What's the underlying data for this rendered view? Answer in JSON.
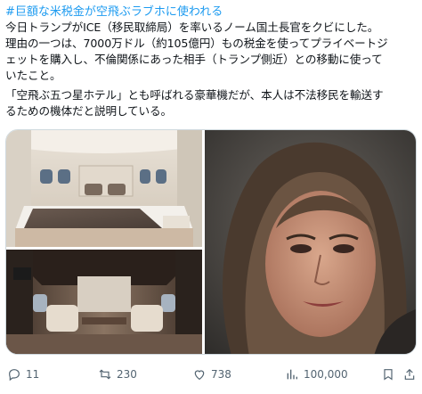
{
  "tweet": {
    "hashtag": "#巨額な米税金が空飛ぶラブホに使われる",
    "lines": [
      "今日トランプがICE（移民取締局）を率いるノーム国土長官をクビにした。",
      "理由の一つは、7000万ドル（約105億円）もの税金を使ってプライベートジ",
      "ェットを購入し、不倫関係にあった相手（トランプ側近）との移動に使って",
      "いたこと。",
      "「空飛ぶ五つ星ホテル」とも呼ばれる豪華機だが、本人は不法移民を輸送す",
      "るための機体だと説明している。"
    ]
  },
  "media": {
    "images": [
      {
        "name": "jet-bedroom-photo"
      },
      {
        "name": "jet-lounge-photo"
      },
      {
        "name": "woman-portrait-photo"
      }
    ]
  },
  "actions": {
    "reply_count": "11",
    "retweet_count": "230",
    "like_count": "738",
    "view_count": "100,000",
    "icons": [
      "reply-icon",
      "retweet-icon",
      "like-icon",
      "views-icon",
      "bookmark-icon",
      "share-icon"
    ],
    "icon_color": "#536471"
  },
  "colors": {
    "hashtag": "#1d9bf0",
    "text": "#0f1419",
    "border": "#cfd9de"
  }
}
